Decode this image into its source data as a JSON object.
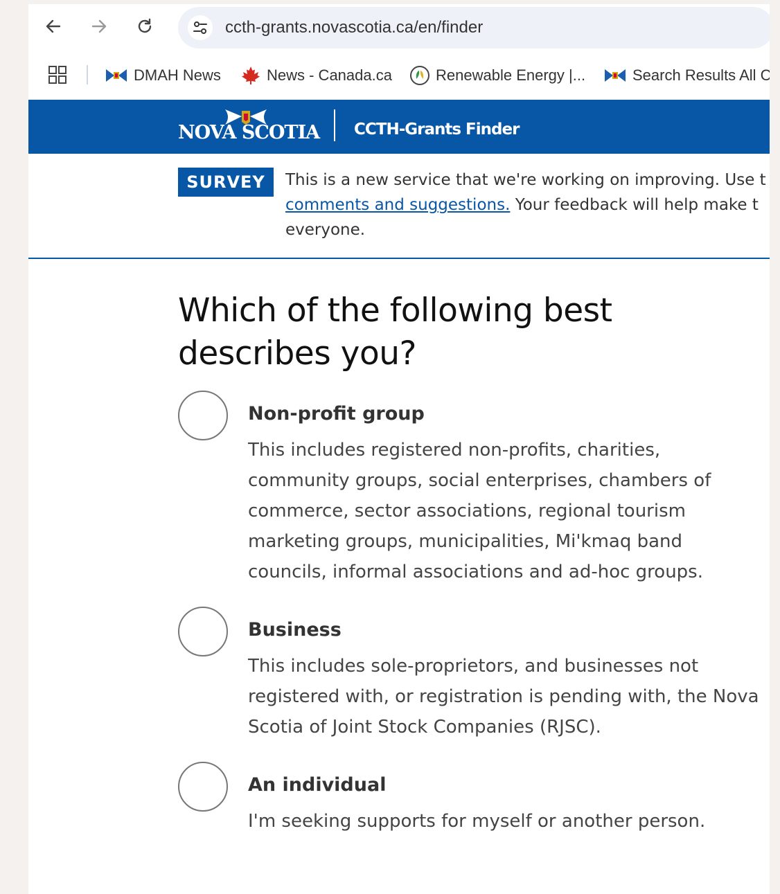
{
  "browser": {
    "back_icon": "arrow-left-icon",
    "forward_icon": "arrow-right-icon",
    "reload_icon": "reload-icon",
    "url": "ccth-grants.novascotia.ca/en/finder",
    "bookmarks": [
      {
        "label": "DMAH News",
        "icon": "nova-scotia-flag-icon"
      },
      {
        "label": "News - Canada.ca",
        "icon": "maple-leaf-icon"
      },
      {
        "label": "Renewable Energy |...",
        "icon": "renewable-energy-icon"
      },
      {
        "label": "Search Results All C...",
        "icon": "nova-scotia-flag-icon"
      }
    ]
  },
  "header": {
    "logo_text": "NOVA SCOTIA",
    "app_title": "CCTH-Grants Finder",
    "brand_color": "#0857a6"
  },
  "survey": {
    "badge": "SURVEY",
    "line1": "This is a new service that we're working on improving. Use t",
    "link": "comments and suggestions.",
    "line2_rest": " Your feedback will help make t",
    "line3": "everyone."
  },
  "main": {
    "question": "Which of the following best describes you?",
    "options": [
      {
        "title": "Non-profit group",
        "description": "This includes registered non-profits, charities, community groups, social enterprises, chambers of commerce, sector associations, regional tourism marketing groups, municipalities, Mi'kmaq band councils, informal associations and ad-hoc groups."
      },
      {
        "title": "Business",
        "description": "This includes sole-proprietors, and businesses not registered with, or registration is pending with, the Nova Scotia of Joint Stock Companies (RJSC)."
      },
      {
        "title": "An individual",
        "description": "I'm seeking supports for myself or another person."
      }
    ]
  }
}
